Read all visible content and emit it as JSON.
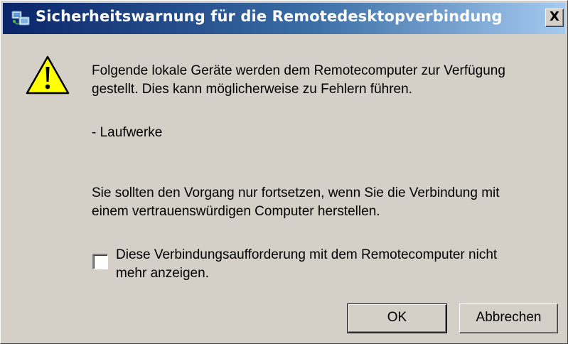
{
  "window": {
    "title": "Sicherheitswarnung für die Remotedesktopverbindung",
    "close_label": "X",
    "title_icon": "remote-desktop-icon"
  },
  "content": {
    "warning_icon": "warning-triangle-icon",
    "message_line1": "Folgende lokale Geräte werden dem Remotecomputer zur Verfügung",
    "message_line2": "gestellt. Dies kann möglicherweise zu Fehlern führen.",
    "device_item": "- Laufwerke",
    "advice_line1": "Sie sollten den Vorgang nur fortsetzen, wenn Sie die Verbindung mit",
    "advice_line2": "einem vertrauenswürdigen Computer herstellen."
  },
  "checkbox": {
    "checked": false,
    "label_line1": "Diese Verbindungsaufforderung mit dem Remotecomputer nicht",
    "label_line2": "mehr anzeigen."
  },
  "buttons": {
    "ok_label": "OK",
    "cancel_label": "Abbrechen"
  },
  "colors": {
    "titlebar_start": "#0a246a",
    "titlebar_end": "#a6caf0",
    "dialog_face": "#d4d0c8",
    "warning_fill": "#ffff00"
  }
}
